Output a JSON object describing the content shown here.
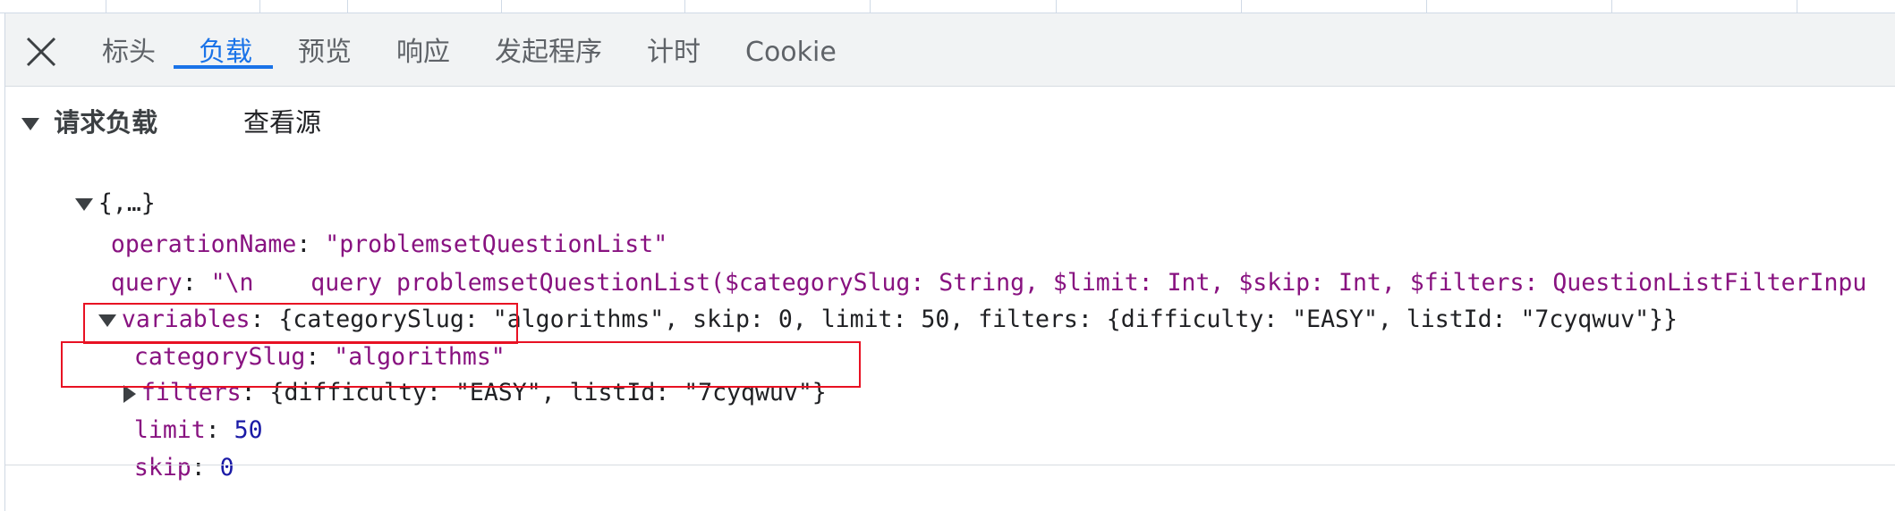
{
  "tabs": [
    {
      "label": "标头",
      "active": false
    },
    {
      "label": "负载",
      "active": true
    },
    {
      "label": "预览",
      "active": false
    },
    {
      "label": "响应",
      "active": false
    },
    {
      "label": "发起程序",
      "active": false
    },
    {
      "label": "计时",
      "active": false
    },
    {
      "label": "Cookie",
      "active": false
    }
  ],
  "section": {
    "title": "请求负载",
    "view_source": "查看源"
  },
  "payload": {
    "root_label": "{,…}",
    "operationName": {
      "key": "operationName",
      "value": "\"problemsetQuestionList\""
    },
    "query": {
      "key": "query",
      "value": "\"\\n    query problemsetQuestionList($categorySlug: String, $limit: Int, $skip: Int, $filters: QuestionListFilterInpu"
    },
    "variables": {
      "key": "variables",
      "summary": "{categorySlug: \"algorithms\", skip: 0, limit: 50, filters: {difficulty: \"EASY\", listId: \"7cyqwuv\"}}",
      "categorySlug": {
        "key": "categorySlug",
        "value": "\"algorithms\""
      },
      "filters": {
        "key": "filters",
        "summary": "{difficulty: \"EASY\", listId: \"7cyqwuv\"}"
      },
      "limit": {
        "key": "limit",
        "value": "50"
      },
      "skip": {
        "key": "skip",
        "value": "0"
      }
    }
  },
  "colors": {
    "accent": "#1a73e8",
    "key": "#881280",
    "number": "#1a1aa6",
    "highlight": "#e81123"
  }
}
